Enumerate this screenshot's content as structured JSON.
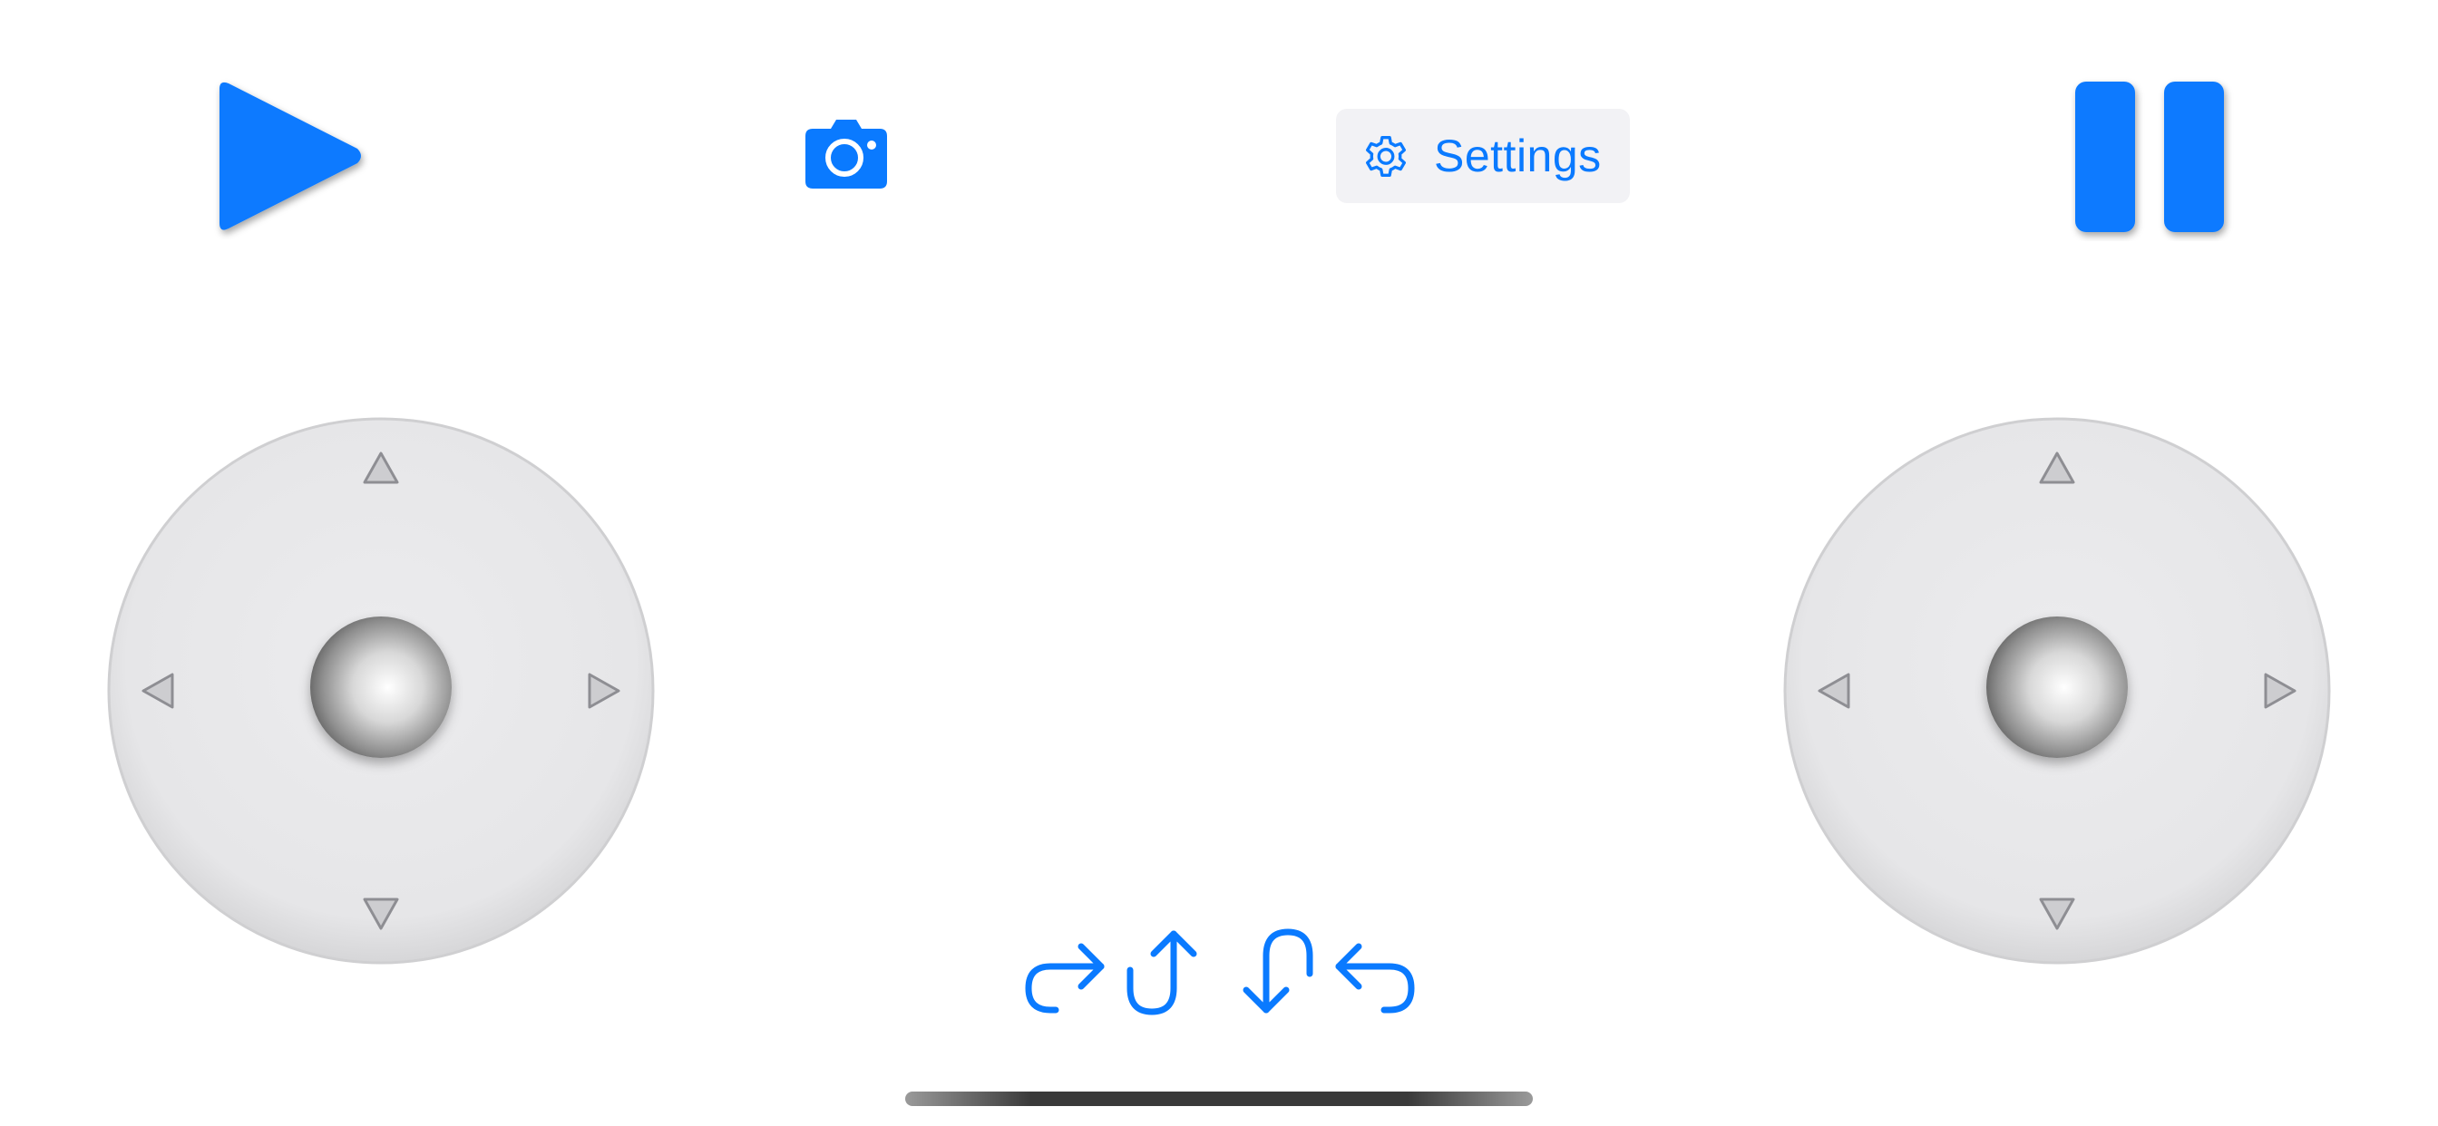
{
  "toolbar": {
    "play_icon": "play-icon",
    "camera_icon": "camera-icon",
    "settings_label": "Settings",
    "settings_icon": "gear-icon",
    "pause_icon": "pause-icon"
  },
  "joysticks": {
    "left": {
      "icon": "joystick",
      "directions": [
        "up-arrow-icon",
        "down-arrow-icon",
        "left-arrow-icon",
        "right-arrow-icon"
      ]
    },
    "right": {
      "icon": "joystick",
      "directions": [
        "up-arrow-icon",
        "down-arrow-icon",
        "left-arrow-icon",
        "right-arrow-icon"
      ]
    }
  },
  "rotation_controls": [
    {
      "icon": "arrow-turn-up-right-icon"
    },
    {
      "icon": "arrow-uturn-up-icon"
    },
    {
      "icon": "arrow-uturn-down-icon"
    },
    {
      "icon": "arrow-turn-up-left-icon"
    }
  ],
  "colors": {
    "accent": "#0a7aff",
    "pad": "#e9e9eb",
    "button_bg": "#f2f2f5"
  }
}
